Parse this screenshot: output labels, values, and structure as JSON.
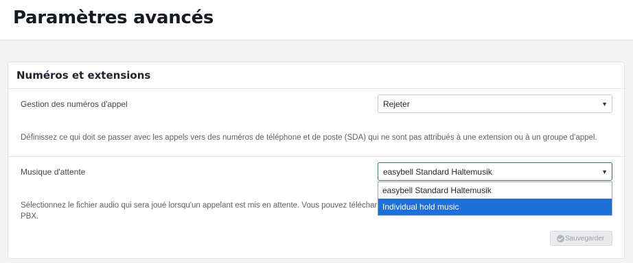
{
  "page": {
    "title": "Paramètres avancés"
  },
  "section": {
    "title": "Numéros et extensions",
    "rows": [
      {
        "label": "Gestion des numéros d'appel",
        "value": "Rejeter",
        "description": "Définissez ce qui doit se passer avec les appels vers des numéros de téléphone et de poste (SDA) qui ne sont pas attribués à une extension ou à un groupe d'appel."
      },
      {
        "label": "Musique d'attente",
        "value": "easybell Standard Haltemusik",
        "description_line1": "Sélectionnez le fichier audio qui sera joué lorsqu'un appelant est mis en attente. Vous pouvez télécharg",
        "description_line2": "PBX.",
        "options": [
          "easybell Standard Haltemusik",
          "Individual hold music"
        ],
        "highlighted_option": "Individual hold music"
      }
    ],
    "save_label": "Sauvegarder"
  },
  "icons": {
    "chevron": "chevron-down-icon",
    "save": "check-circle-icon"
  },
  "colors": {
    "focus_border": "#2f7a6e",
    "highlight": "#1f6fd6"
  }
}
